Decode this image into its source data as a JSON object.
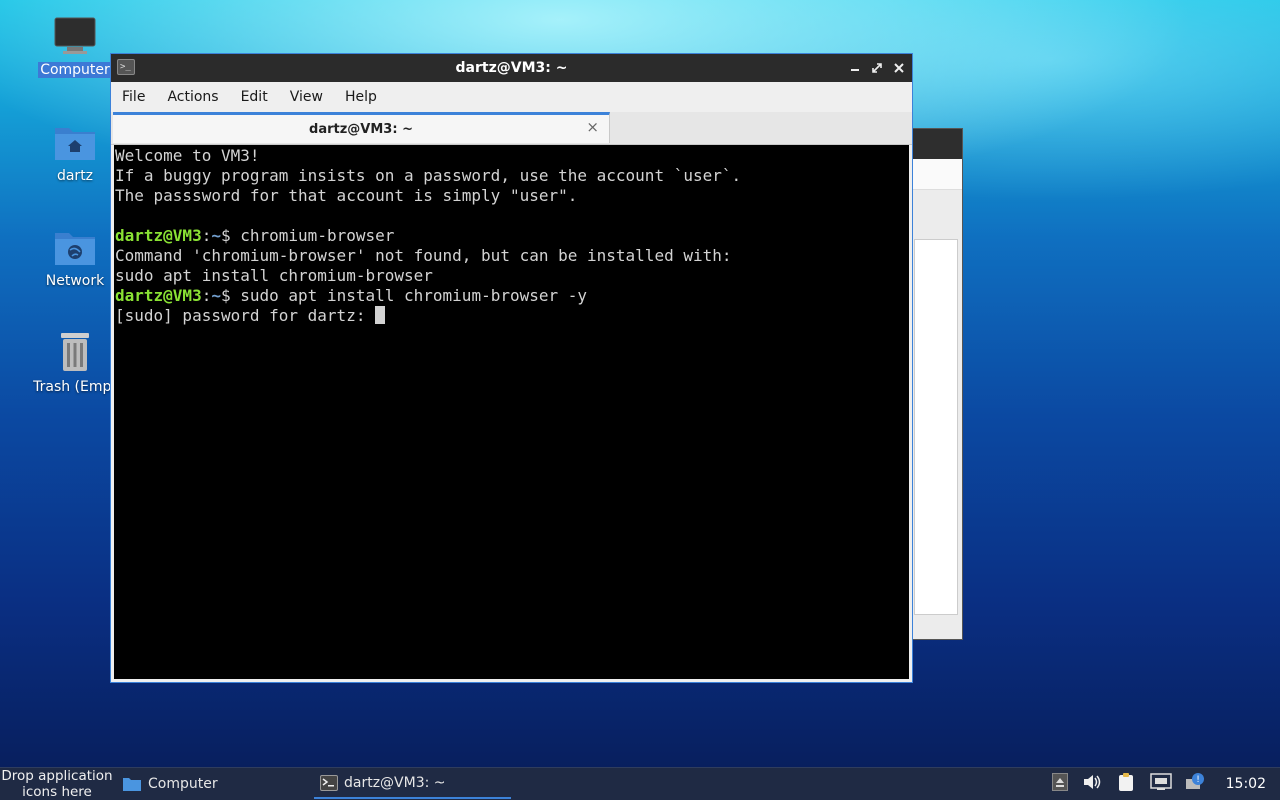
{
  "desktop": {
    "icons": [
      {
        "label": "Computer"
      },
      {
        "label": "dartz"
      },
      {
        "label": "Network"
      },
      {
        "label": "Trash (Empt"
      }
    ]
  },
  "terminal": {
    "window_title": "dartz@VM3: ~",
    "menu": [
      "File",
      "Actions",
      "Edit",
      "View",
      "Help"
    ],
    "tab_title": "dartz@VM3: ~",
    "tab_close": "×",
    "lines": {
      "l1": "Welcome to VM3!",
      "l2": "If a buggy program insists on a password, use the account `user`.",
      "l3": "The passsword for that account is simply \"user\".",
      "p1_user": "dartz@VM3",
      "p1_sep": ":",
      "p1_path": "~",
      "p1_cmd": "$ chromium-browser",
      "l5": "Command 'chromium-browser' not found, but can be installed with:",
      "l6": "sudo apt install chromium-browser",
      "p2_user": "dartz@VM3",
      "p2_sep": ":",
      "p2_path": "~",
      "p2_cmd": "$ sudo apt install chromium-browser -y",
      "l8": "[sudo] password for dartz: "
    }
  },
  "taskbar": {
    "drop_hint_line1": "Drop application",
    "drop_hint_line2": "icons here",
    "tasks": [
      {
        "label": "Computer"
      },
      {
        "label": "dartz@VM3: ~"
      }
    ],
    "clock": "15:02"
  },
  "colors": {
    "accent": "#3c82d9",
    "prompt_user": "#8ae234",
    "prompt_path": "#729fcf"
  }
}
